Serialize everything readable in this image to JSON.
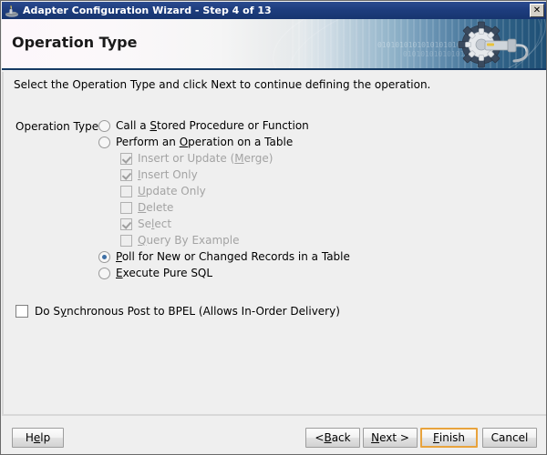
{
  "window": {
    "title": "Adapter Configuration Wizard - Step 4 of 13",
    "icon": "lamp-icon",
    "close_label": "✕"
  },
  "banner": {
    "heading": "Operation Type",
    "decor_icon": "gear-wrench-icon",
    "binary_text_1": "0101010101010101010101010101",
    "binary_text_2": "010101010101010"
  },
  "content": {
    "instruction": "Select the Operation Type and click Next to continue defining the operation.",
    "operation_type_label": "Operation Type:",
    "options": [
      {
        "type": "radio",
        "name": "call-stored-procedure",
        "label_before": "Call a ",
        "mnemonic": "S",
        "label_after": "tored Procedure or Function",
        "checked": false,
        "disabled": false,
        "indent": false
      },
      {
        "type": "radio",
        "name": "perform-operation-on-table",
        "label_before": "Perform an ",
        "mnemonic": "O",
        "label_after": "peration on a Table",
        "checked": false,
        "disabled": false,
        "indent": false
      },
      {
        "type": "checkbox",
        "name": "insert-or-update-merge",
        "label_before": "Insert or Update (",
        "mnemonic": "M",
        "label_after": "erge)",
        "checked": true,
        "disabled": true,
        "indent": true
      },
      {
        "type": "checkbox",
        "name": "insert-only",
        "label_before": "",
        "mnemonic": "I",
        "label_after": "nsert Only",
        "checked": true,
        "disabled": true,
        "indent": true
      },
      {
        "type": "checkbox",
        "name": "update-only",
        "label_before": "",
        "mnemonic": "U",
        "label_after": "pdate Only",
        "checked": false,
        "disabled": true,
        "indent": true
      },
      {
        "type": "checkbox",
        "name": "delete",
        "label_before": "",
        "mnemonic": "D",
        "label_after": "elete",
        "checked": false,
        "disabled": true,
        "indent": true
      },
      {
        "type": "checkbox",
        "name": "select",
        "label_before": "Se",
        "mnemonic": "l",
        "label_after": "ect",
        "checked": true,
        "disabled": true,
        "indent": true
      },
      {
        "type": "checkbox",
        "name": "query-by-example",
        "label_before": "",
        "mnemonic": "Q",
        "label_after": "uery By Example",
        "checked": false,
        "disabled": true,
        "indent": true
      },
      {
        "type": "radio",
        "name": "poll-for-new-or-changed-records",
        "label_before": "",
        "mnemonic": "P",
        "label_after": "oll for New or Changed Records in a Table",
        "checked": true,
        "disabled": false,
        "indent": false
      },
      {
        "type": "radio",
        "name": "execute-pure-sql",
        "label_before": "",
        "mnemonic": "E",
        "label_after": "xecute Pure SQL",
        "checked": false,
        "disabled": false,
        "indent": false
      }
    ],
    "sync_post": {
      "label_before": "Do S",
      "mnemonic": "y",
      "label_after": "nchronous Post to BPEL (Allows In-Order Delivery)",
      "checked": false
    }
  },
  "buttons": {
    "help": {
      "before": "H",
      "mnemonic": "e",
      "after": "lp"
    },
    "back": {
      "before": "< ",
      "mnemonic": "B",
      "after": "ack"
    },
    "next": {
      "before": "",
      "mnemonic": "N",
      "after": "ext >"
    },
    "finish": {
      "before": "",
      "mnemonic": "F",
      "after": "inish",
      "default": true
    },
    "cancel": {
      "before": "Cancel",
      "mnemonic": "",
      "after": ""
    }
  },
  "colors": {
    "titlebar": "#1e3d7e",
    "dialog_face": "#efefef",
    "default_button_border": "#e8a33d",
    "radio_dot": "#3d6fa5",
    "disabled_text": "#a3a3a3"
  }
}
